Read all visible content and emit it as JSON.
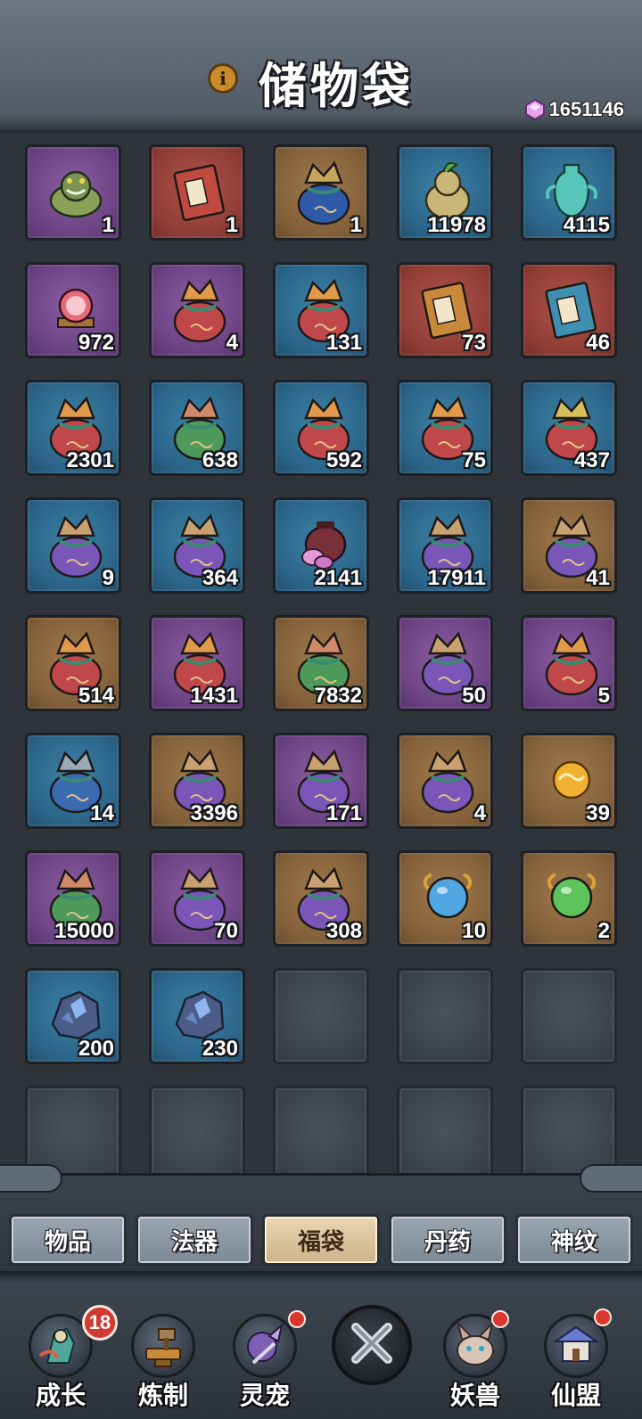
{
  "header": {
    "title": "储物袋",
    "info_icon": "i",
    "currency": {
      "icon": "spirit-stone-gem-icon",
      "value": "1651146",
      "color": "#d98ae8"
    }
  },
  "inventory": {
    "slots": [
      {
        "frame": "purple",
        "icon": "toad-spirit-pouch-icon",
        "count": "1"
      },
      {
        "frame": "red",
        "icon": "red-scroll-book-icon",
        "count": "1"
      },
      {
        "frame": "brown",
        "icon": "jade-pouch-icon",
        "count": "1"
      },
      {
        "frame": "blue",
        "icon": "sprout-beast-icon",
        "count": "11978"
      },
      {
        "frame": "blue",
        "icon": "jade-vase-icon",
        "count": "4115"
      },
      {
        "frame": "purple",
        "icon": "cultivation-orb-icon",
        "count": "972"
      },
      {
        "frame": "purple",
        "icon": "ore-bag-icon",
        "count": "4"
      },
      {
        "frame": "blue",
        "icon": "ore-bag-icon",
        "count": "131"
      },
      {
        "frame": "red",
        "icon": "dao-book-icon",
        "count": "73"
      },
      {
        "frame": "red",
        "icon": "virtue-book-icon",
        "count": "46"
      },
      {
        "frame": "blue",
        "icon": "equipment-bag-red-icon",
        "count": "2301"
      },
      {
        "frame": "blue",
        "icon": "equipment-bag-green-icon",
        "count": "638"
      },
      {
        "frame": "blue",
        "icon": "treasure-bag-red-icon",
        "count": "592"
      },
      {
        "frame": "blue",
        "icon": "ore-bag-red-icon",
        "count": "75"
      },
      {
        "frame": "blue",
        "icon": "crystal-bag-icon",
        "count": "437"
      },
      {
        "frame": "blue",
        "icon": "weapon-bag-purple-icon",
        "count": "9"
      },
      {
        "frame": "blue",
        "icon": "orb-bag-purple-icon",
        "count": "364"
      },
      {
        "frame": "blue",
        "icon": "elixir-pot-icon",
        "count": "2141"
      },
      {
        "frame": "blue",
        "icon": "scroll-bag-blue-icon",
        "count": "17911"
      },
      {
        "frame": "brown",
        "icon": "equipment-bag-purple-icon",
        "count": "41"
      },
      {
        "frame": "brown",
        "icon": "equipment-bag-red-icon",
        "count": "514"
      },
      {
        "frame": "purple",
        "icon": "treasure-bag-red-icon",
        "count": "1431"
      },
      {
        "frame": "brown",
        "icon": "equipment-bag-green-icon",
        "count": "7832"
      },
      {
        "frame": "purple",
        "icon": "orb-bag-purple-icon",
        "count": "50"
      },
      {
        "frame": "purple",
        "icon": "equipment-bag-red-icon",
        "count": "5"
      },
      {
        "frame": "blue",
        "icon": "stone-bag-blue-icon",
        "count": "14"
      },
      {
        "frame": "brown",
        "icon": "orb-bag-purple-icon",
        "count": "3396"
      },
      {
        "frame": "purple",
        "icon": "pearl-bag-icon",
        "count": "171"
      },
      {
        "frame": "brown",
        "icon": "pearl-bag-icon",
        "count": "4"
      },
      {
        "frame": "brown",
        "icon": "golden-cloud-orb-icon",
        "count": "39"
      },
      {
        "frame": "purple",
        "icon": "banner-bag-green-icon",
        "count": "15000"
      },
      {
        "frame": "purple",
        "icon": "book-bag-purple-icon",
        "count": "70"
      },
      {
        "frame": "brown",
        "icon": "book-bag-purple-icon",
        "count": "308"
      },
      {
        "frame": "brown",
        "icon": "blue-spirit-orb-icon",
        "count": "10"
      },
      {
        "frame": "brown",
        "icon": "green-spirit-orb-icon",
        "count": "2"
      },
      {
        "frame": "blue",
        "icon": "dark-crystal-ore-icon",
        "count": "200"
      },
      {
        "frame": "blue",
        "icon": "dark-crystal-ore-icon",
        "count": "230"
      },
      {
        "frame": "empty",
        "icon": "",
        "count": ""
      },
      {
        "frame": "empty",
        "icon": "",
        "count": ""
      },
      {
        "frame": "empty",
        "icon": "",
        "count": ""
      },
      {
        "frame": "empty",
        "icon": "",
        "count": ""
      },
      {
        "frame": "empty",
        "icon": "",
        "count": ""
      },
      {
        "frame": "empty",
        "icon": "",
        "count": ""
      },
      {
        "frame": "empty",
        "icon": "",
        "count": ""
      },
      {
        "frame": "empty",
        "icon": "",
        "count": ""
      }
    ]
  },
  "tabs": {
    "items": [
      {
        "label": "物品",
        "active": false
      },
      {
        "label": "法器",
        "active": false
      },
      {
        "label": "福袋",
        "active": true
      },
      {
        "label": "丹药",
        "active": false
      },
      {
        "label": "神纹",
        "active": false
      }
    ]
  },
  "bottom_nav": {
    "growth": {
      "label": "成长",
      "icon": "growth-warrior-icon",
      "badge": "18"
    },
    "refine": {
      "label": "炼制",
      "icon": "anvil-hammer-icon"
    },
    "pet": {
      "label": "灵宠",
      "icon": "pet-spirit-icon"
    },
    "close": {
      "icon": "close-x-icon"
    },
    "beast": {
      "label": "妖兽",
      "icon": "demon-beast-icon"
    },
    "alliance": {
      "label": "仙盟",
      "icon": "alliance-pavilion-icon"
    }
  },
  "colors": {
    "frame_purple": "#6b4282",
    "frame_red": "#8f3d36",
    "frame_brown": "#82603a",
    "frame_blue": "#2b6488",
    "badge_red": "#d13a30",
    "active_tab": "#cdb48a"
  }
}
